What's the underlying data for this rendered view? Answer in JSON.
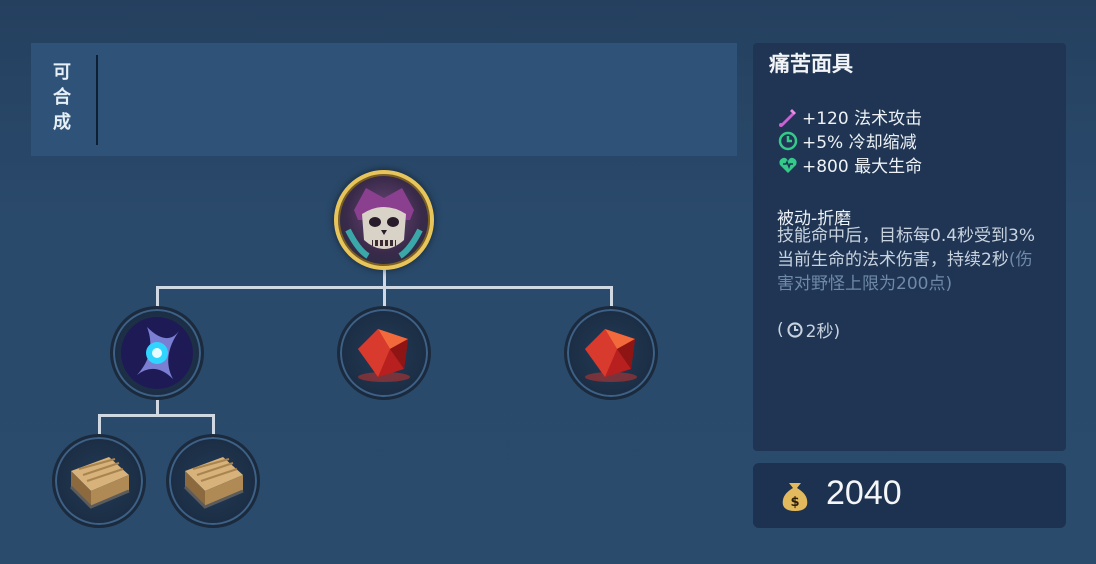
{
  "compose": {
    "label_chars": [
      "可",
      "合",
      "成"
    ]
  },
  "tree": {
    "root": {
      "icon": "skull-mask-icon"
    },
    "children": [
      {
        "icon": "arcane-orb-icon"
      },
      {
        "icon": "red-crystal-icon"
      },
      {
        "icon": "red-crystal-icon"
      }
    ],
    "grandchildren": [
      {
        "icon": "wooden-book-icon"
      },
      {
        "icon": "wooden-book-icon"
      }
    ]
  },
  "item": {
    "name": "痛苦面具",
    "stats": [
      {
        "icon": "magic-attack-icon",
        "text": "+120 法术攻击",
        "color": "#d05fd6"
      },
      {
        "icon": "cooldown-icon",
        "text": "+5% 冷却缩减",
        "color": "#35c98a"
      },
      {
        "icon": "heart-icon",
        "text": "+800 最大生命",
        "color": "#35c98a"
      }
    ],
    "passive": {
      "name": "被动-折磨",
      "desc_main": "技能命中后，目标每0.4秒受到3%当前生命的法术伤害，持续2秒",
      "desc_note": "(伤害对野怪上限为200点)",
      "cooldown_prefix": "(",
      "cooldown_text": "2秒)"
    }
  },
  "price": {
    "icon": "money-bag-icon",
    "value": "2040"
  }
}
